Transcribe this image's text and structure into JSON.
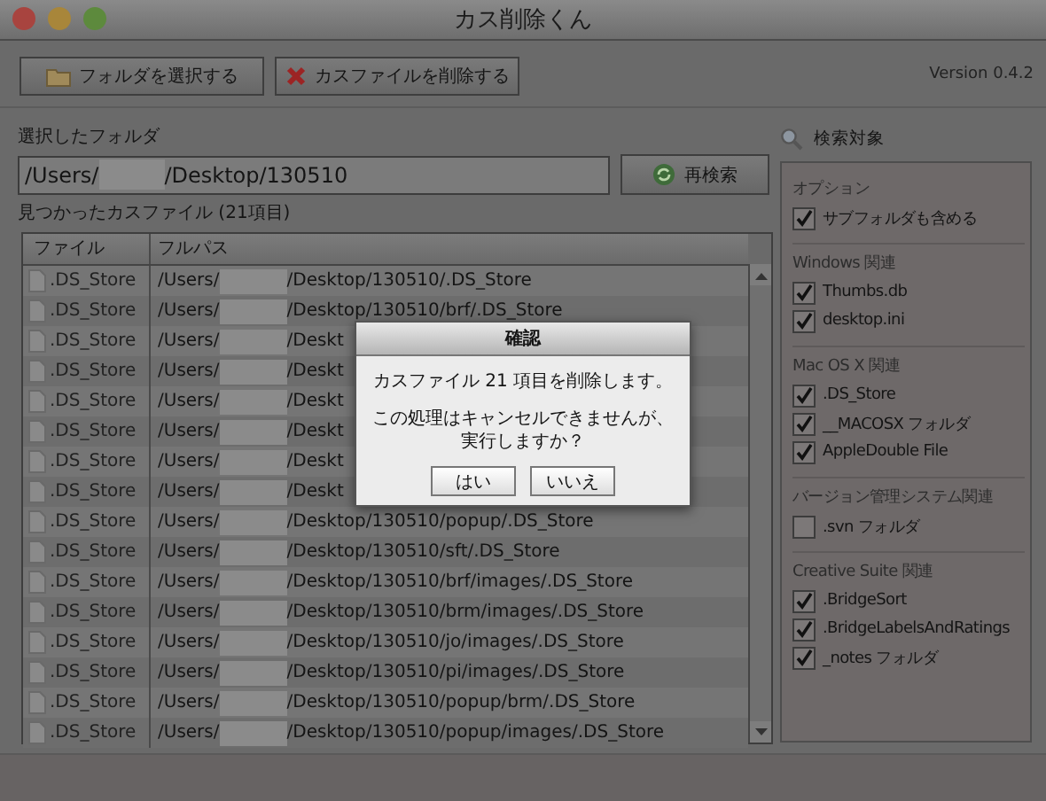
{
  "window": {
    "title": "カス削除くん"
  },
  "toolbar": {
    "buttons": [
      {
        "label": "フォルダを選択する",
        "kind": "folder"
      },
      {
        "label": "カスファイルを削除する",
        "kind": "delete"
      }
    ],
    "version": "Version 0.4.2"
  },
  "folder": {
    "label": "選択したフォルダ",
    "path_prefix": "/Users/",
    "path_suffix": "/Desktop/130510",
    "redacted": true,
    "rescan_button": "再検索"
  },
  "results": {
    "label": "見つかったカスファイル (21項目)",
    "redacted": true,
    "columns": [
      "ファイル",
      "フルパス"
    ],
    "rows": [
      {
        "file": ".DS_Store",
        "path_prefix": "/Users/",
        "path_suffix": "/Desktop/130510/.DS_Store"
      },
      {
        "file": ".DS_Store",
        "path_prefix": "/Users/",
        "path_suffix": "/Desktop/130510/brf/.DS_Store"
      },
      {
        "file": ".DS_Store",
        "path_prefix": "/Users/",
        "path_suffix": "/Deskt"
      },
      {
        "file": ".DS_Store",
        "path_prefix": "/Users/",
        "path_suffix": "/Deskt"
      },
      {
        "file": ".DS_Store",
        "path_prefix": "/Users/",
        "path_suffix": "/Deskt"
      },
      {
        "file": ".DS_Store",
        "path_prefix": "/Users/",
        "path_suffix": "/Deskt"
      },
      {
        "file": ".DS_Store",
        "path_prefix": "/Users/",
        "path_suffix": "/Deskt"
      },
      {
        "file": ".DS_Store",
        "path_prefix": "/Users/",
        "path_suffix": "/Deskt"
      },
      {
        "file": ".DS_Store",
        "path_prefix": "/Users/",
        "path_suffix": "/Desktop/130510/popup/.DS_Store"
      },
      {
        "file": ".DS_Store",
        "path_prefix": "/Users/",
        "path_suffix": "/Desktop/130510/sft/.DS_Store"
      },
      {
        "file": ".DS_Store",
        "path_prefix": "/Users/",
        "path_suffix": "/Desktop/130510/brf/images/.DS_Store"
      },
      {
        "file": ".DS_Store",
        "path_prefix": "/Users/",
        "path_suffix": "/Desktop/130510/brm/images/.DS_Store"
      },
      {
        "file": ".DS_Store",
        "path_prefix": "/Users/",
        "path_suffix": "/Desktop/130510/jo/images/.DS_Store"
      },
      {
        "file": ".DS_Store",
        "path_prefix": "/Users/",
        "path_suffix": "/Desktop/130510/pi/images/.DS_Store"
      },
      {
        "file": ".DS_Store",
        "path_prefix": "/Users/",
        "path_suffix": "/Desktop/130510/popup/brm/.DS_Store"
      },
      {
        "file": ".DS_Store",
        "path_prefix": "/Users/",
        "path_suffix": "/Desktop/130510/popup/images/.DS_Store"
      }
    ]
  },
  "search_targets": {
    "title": "検索対象",
    "groups": [
      {
        "title": "オプション",
        "items": [
          {
            "label": "サブフォルダも含める",
            "checked": true
          }
        ]
      },
      {
        "title": "Windows 関連",
        "items": [
          {
            "label": "Thumbs.db",
            "checked": true
          },
          {
            "label": "desktop.ini",
            "checked": true
          }
        ]
      },
      {
        "title": "Mac OS X 関連",
        "items": [
          {
            "label": ".DS_Store",
            "checked": true
          },
          {
            "label": "__MACOSX フォルダ",
            "checked": true
          },
          {
            "label": "AppleDouble File",
            "checked": true
          }
        ]
      },
      {
        "title": "バージョン管理システム関連",
        "items": [
          {
            "label": ".svn フォルダ",
            "checked": false
          }
        ]
      },
      {
        "title": "Creative Suite 関連",
        "items": [
          {
            "label": ".BridgeSort",
            "checked": true
          },
          {
            "label": ".BridgeLabelsAndRatings",
            "checked": true
          },
          {
            "label": "_notes フォルダ",
            "checked": true
          }
        ]
      }
    ]
  },
  "dialog": {
    "title": "確認",
    "message": "カスファイル 21 項目を削除します。",
    "question_lines": [
      "この処理はキャンセルできませんが、",
      "実行しますか？"
    ],
    "buttons": [
      "はい",
      "いいえ"
    ]
  }
}
